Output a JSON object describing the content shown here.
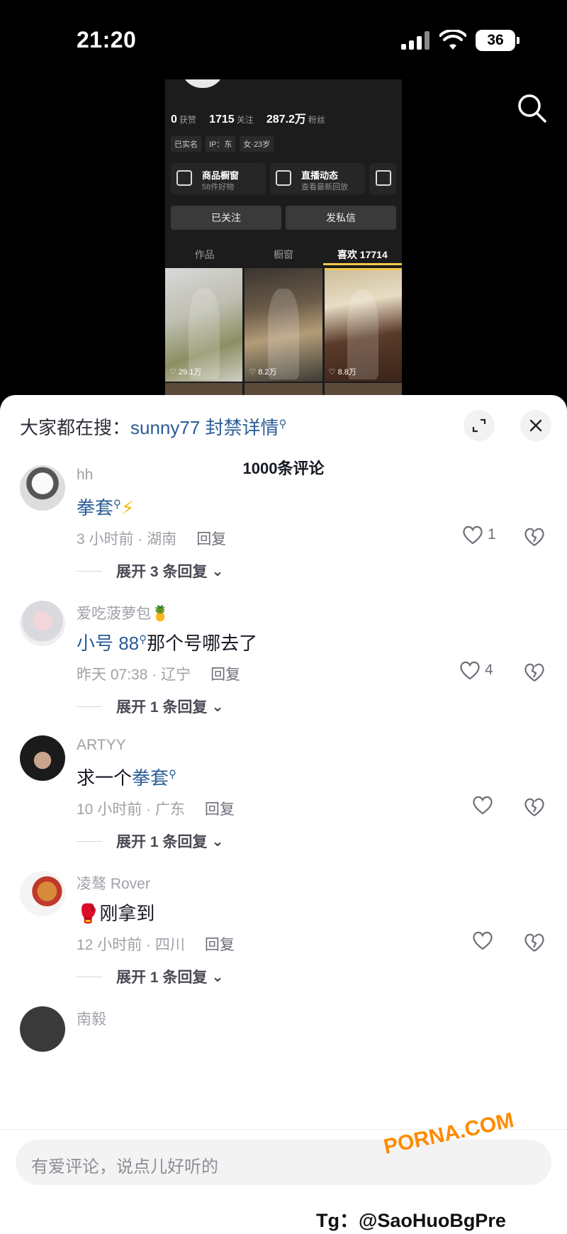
{
  "status_bar": {
    "time": "21:20",
    "battery": "36"
  },
  "profile_preview": {
    "stats": [
      {
        "value": "0",
        "label": "获赞"
      },
      {
        "value": "1715",
        "label": "关注"
      },
      {
        "value": "287.2万",
        "label": "粉丝"
      }
    ],
    "tags": [
      "已实名",
      "IP：",
      "东",
      "女·23岁"
    ],
    "cards": [
      {
        "title": "商品橱窗",
        "sub": "58件好物"
      },
      {
        "title": "直播动态",
        "sub": "查看最新回放"
      }
    ],
    "follow_button": "已关注",
    "message_button": "发私信",
    "tabs": [
      "作品",
      "橱窗",
      "喜欢 17714"
    ],
    "thumbnails": [
      {
        "likes": "29.1万"
      },
      {
        "likes": "8.2万"
      },
      {
        "likes": "8.8万"
      }
    ]
  },
  "sheet": {
    "search_prefix": "大家都在搜：",
    "search_keyword": "sunny77 封禁详情",
    "comment_count": "1000条评论",
    "comments": [
      {
        "name": "hh",
        "text_keyword": "拳套",
        "text_suffix": "⚡",
        "time_location": "3 小时前 · 湖南",
        "reply": "回复",
        "likes": "1",
        "expand": "展开 3 条回复"
      },
      {
        "name": "爱吃菠萝包🍍",
        "text_keyword": "小号 88",
        "text_suffix": "那个号哪去了",
        "time_location": "昨天 07:38 · 辽宁",
        "reply": "回复",
        "likes": "4",
        "expand": "展开 1 条回复"
      },
      {
        "name": "ARTYY",
        "text_prefix": "求一个",
        "text_keyword": "拳套",
        "time_location": "10 小时前 · 广东",
        "reply": "回复",
        "likes": "",
        "expand": "展开 1 条回复"
      },
      {
        "name": "凌骜 Rover",
        "text": "🥊刚拿到",
        "time_location": "12 小时前 · 四川",
        "reply": "回复",
        "likes": "",
        "expand": "展开 1 条回复"
      },
      {
        "name": "南毅"
      }
    ]
  },
  "input": {
    "placeholder": "有爱评论，说点儿好听的"
  },
  "watermarks": {
    "handle": "Tg：@SaoHuoBgPre",
    "site": "PORNA.COM"
  },
  "colors": {
    "keyword_blue": "#2b5c96",
    "tab_underline": "#f2c94c"
  }
}
